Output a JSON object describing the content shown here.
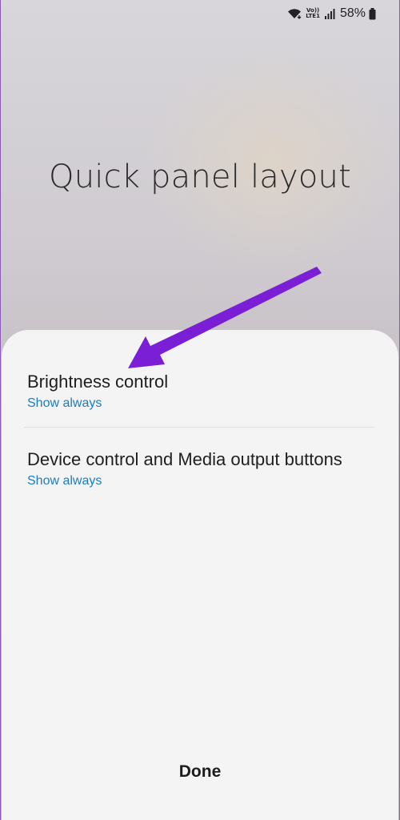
{
  "status_bar": {
    "volte_top": "Vo))",
    "volte_bottom": "LTE1",
    "battery_text": "58%"
  },
  "title": "Quick panel layout",
  "sheet": {
    "items": [
      {
        "title": "Brightness control",
        "value": "Show always"
      },
      {
        "title": "Device control and Media output buttons",
        "value": "Show always"
      }
    ],
    "done_label": "Done"
  },
  "annotation": {
    "arrow_color": "#7a1fd6",
    "target": "Brightness control"
  },
  "colors": {
    "accent": "#1a7cc4",
    "sheet_bg": "#f4f4f5"
  },
  "icons": [
    "wifi-icon",
    "signal-icon",
    "battery-icon"
  ]
}
